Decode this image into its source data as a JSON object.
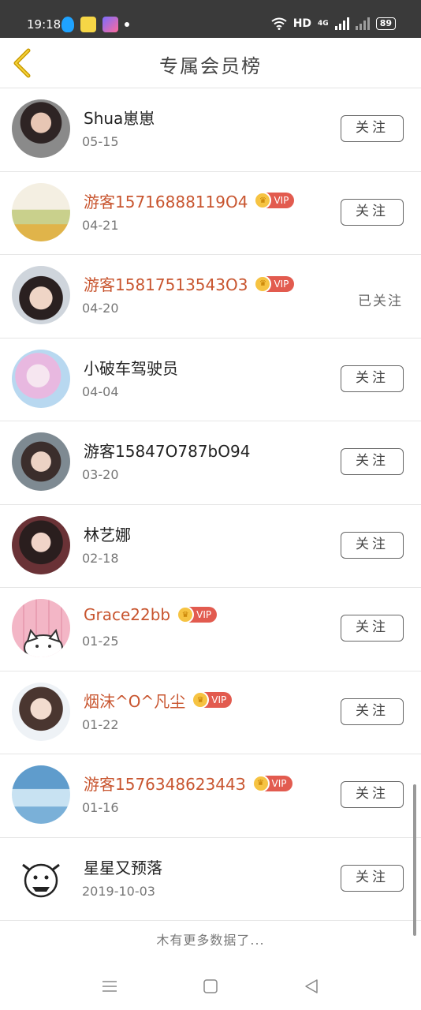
{
  "status_bar": {
    "time": "19:18",
    "network": "HD",
    "signal": "4G",
    "battery": "89"
  },
  "header": {
    "title": "专属会员榜",
    "back_icon": "chevron-left-icon",
    "accent_color": "#c99a00"
  },
  "members": [
    {
      "name": "Shua崽崽",
      "date": "05-15",
      "vip": false,
      "followed": false,
      "avatar_color": "#5a4a48"
    },
    {
      "name": "游客15716888119O4",
      "date": "04-21",
      "vip": true,
      "followed": false,
      "avatar_color": "#d8c8a0"
    },
    {
      "name": "游客15817513543O3",
      "date": "04-20",
      "vip": true,
      "followed": true,
      "avatar_color": "#4a3c3a"
    },
    {
      "name": "小破车驾驶员",
      "date": "04-04",
      "vip": false,
      "followed": false,
      "avatar_color": "#e9cfe8"
    },
    {
      "name": "游客15847O787bO94",
      "date": "03-20",
      "vip": false,
      "followed": false,
      "avatar_color": "#6e5c55"
    },
    {
      "name": "林艺娜",
      "date": "02-18",
      "vip": false,
      "followed": false,
      "avatar_color": "#4d3b3a"
    },
    {
      "name": "Grace22bb",
      "date": "01-25",
      "vip": true,
      "followed": false,
      "avatar_color": "#f0b8c8"
    },
    {
      "name": "烟沫^O^凡尘",
      "date": "01-22",
      "vip": true,
      "followed": false,
      "avatar_color": "#8a7a70"
    },
    {
      "name": "游客157634862344З",
      "date": "01-16",
      "vip": true,
      "followed": false,
      "avatar_color": "#7fb3d4"
    },
    {
      "name": "星星又预落",
      "date": "2019-10-03",
      "vip": false,
      "followed": false,
      "avatar_color": "#ffffff"
    }
  ],
  "labels": {
    "follow": "关注",
    "followed": "已关注",
    "vip": "VIP",
    "no_more": "木有更多数据了..."
  },
  "nav": {
    "menu_icon": "menu-icon",
    "home_icon": "square-icon",
    "back_icon": "triangle-back-icon"
  }
}
